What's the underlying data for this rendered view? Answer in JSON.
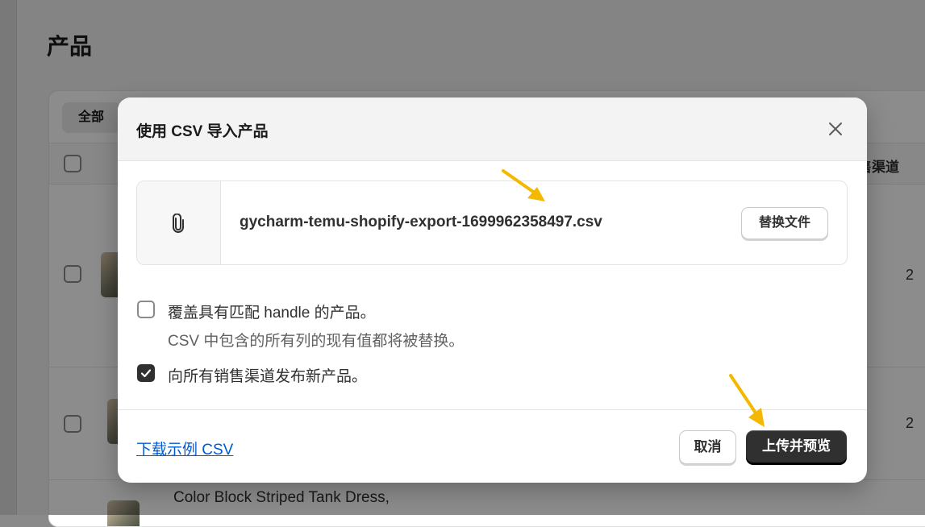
{
  "page": {
    "title": "产品",
    "tab_all": "全部",
    "col_sales_channel": "售渠道",
    "rows": [
      {
        "count": "2"
      },
      {
        "count": "2"
      },
      {
        "title": "Color Block Striped Tank Dress,"
      }
    ]
  },
  "modal": {
    "title": "使用 CSV 导入产品",
    "file_name": "gycharm-temu-shopify-export-1699962358497.csv",
    "replace_button": "替换文件",
    "options": [
      {
        "label": "覆盖具有匹配 handle 的产品。",
        "help": "CSV 中包含的所有列的现有值都将被替换。",
        "checked": false
      },
      {
        "label": "向所有销售渠道发布新产品。",
        "checked": true
      }
    ],
    "sample_link": "下载示例 CSV",
    "cancel_button": "取消",
    "upload_button": "上传并预览"
  },
  "icons": {
    "close": "close-icon",
    "attachment": "paperclip-icon",
    "checkmark": "checkmark-icon",
    "annotation_arrow": "arrow-icon"
  },
  "colors": {
    "primary_button": "#303030",
    "link": "#005bd3",
    "annotation_arrow": "#f5b800"
  }
}
